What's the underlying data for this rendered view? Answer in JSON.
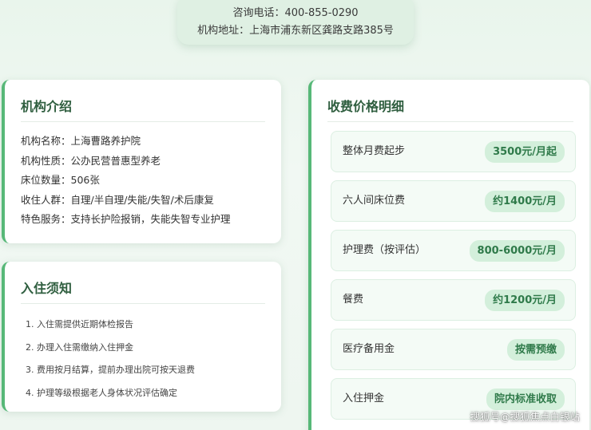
{
  "contact": {
    "phone": "咨询电话：400-855-0290",
    "address": "机构地址：上海市浦东新区龚路支路385号"
  },
  "intro": {
    "title": "机构介绍",
    "lines": [
      "机构名称：上海曹路养护院",
      "机构性质：公办民营普惠型养老",
      "床位数量：506张",
      "收住人群：自理/半自理/失能/失智/术后康复",
      "特色服务：支持长护险报销，失能失智专业护理"
    ]
  },
  "notice": {
    "title": "入住须知",
    "items": [
      "1. 入住需提供近期体检报告",
      "2. 办理入住需缴纳入住押金",
      "3. 费用按月结算，提前办理出院可按天退费",
      "4. 护理等级根据老人身体状况评估确定"
    ]
  },
  "fees": {
    "title": "收费价格明细",
    "rows": [
      {
        "name": "整体月费起步",
        "price": "3500元/月起"
      },
      {
        "name": "六人间床位费",
        "price": "约1400元/月"
      },
      {
        "name": "护理费（按评估）",
        "price": "800-6000元/月"
      },
      {
        "name": "餐费",
        "price": "约1200元/月"
      },
      {
        "name": "医疗备用金",
        "price": "按需预缴"
      },
      {
        "name": "入住押金",
        "price": "院内标准收取"
      }
    ]
  },
  "watermark": "搜狐号@搜狐焦点白银站"
}
